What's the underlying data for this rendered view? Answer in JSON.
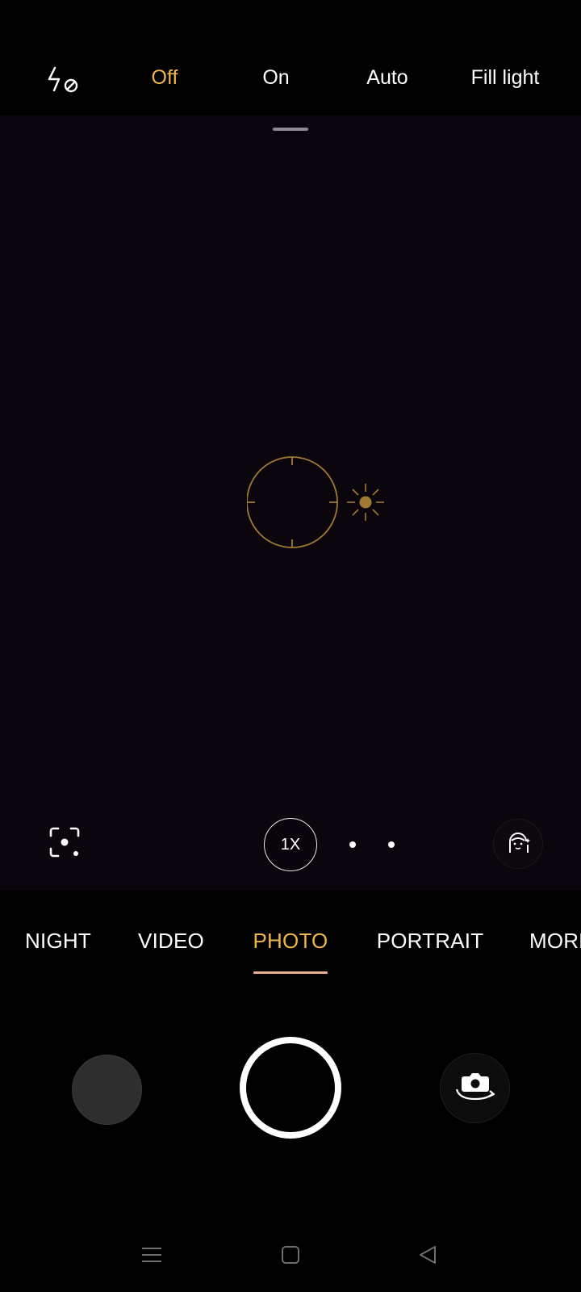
{
  "flash": {
    "icon": "flash-off-icon",
    "options": [
      "Off",
      "On",
      "Auto",
      "Fill light"
    ],
    "selected": "Off",
    "accent_color": "#f0b54a"
  },
  "viewfinder": {
    "zoom_label": "1X",
    "icons": [
      "lens-scan-icon",
      "focus-ring-icon",
      "exposure-sun-icon",
      "ai-beauty-icon"
    ]
  },
  "modes": {
    "items": [
      "NIGHT",
      "VIDEO",
      "PHOTO",
      "PORTRAIT",
      "MORE"
    ],
    "selected": "PHOTO"
  },
  "controls": {
    "icons": [
      "gallery-thumbnail",
      "shutter-button",
      "switch-camera-icon"
    ]
  },
  "navbar": {
    "icons": [
      "menu-icon",
      "home-icon",
      "back-icon"
    ]
  }
}
